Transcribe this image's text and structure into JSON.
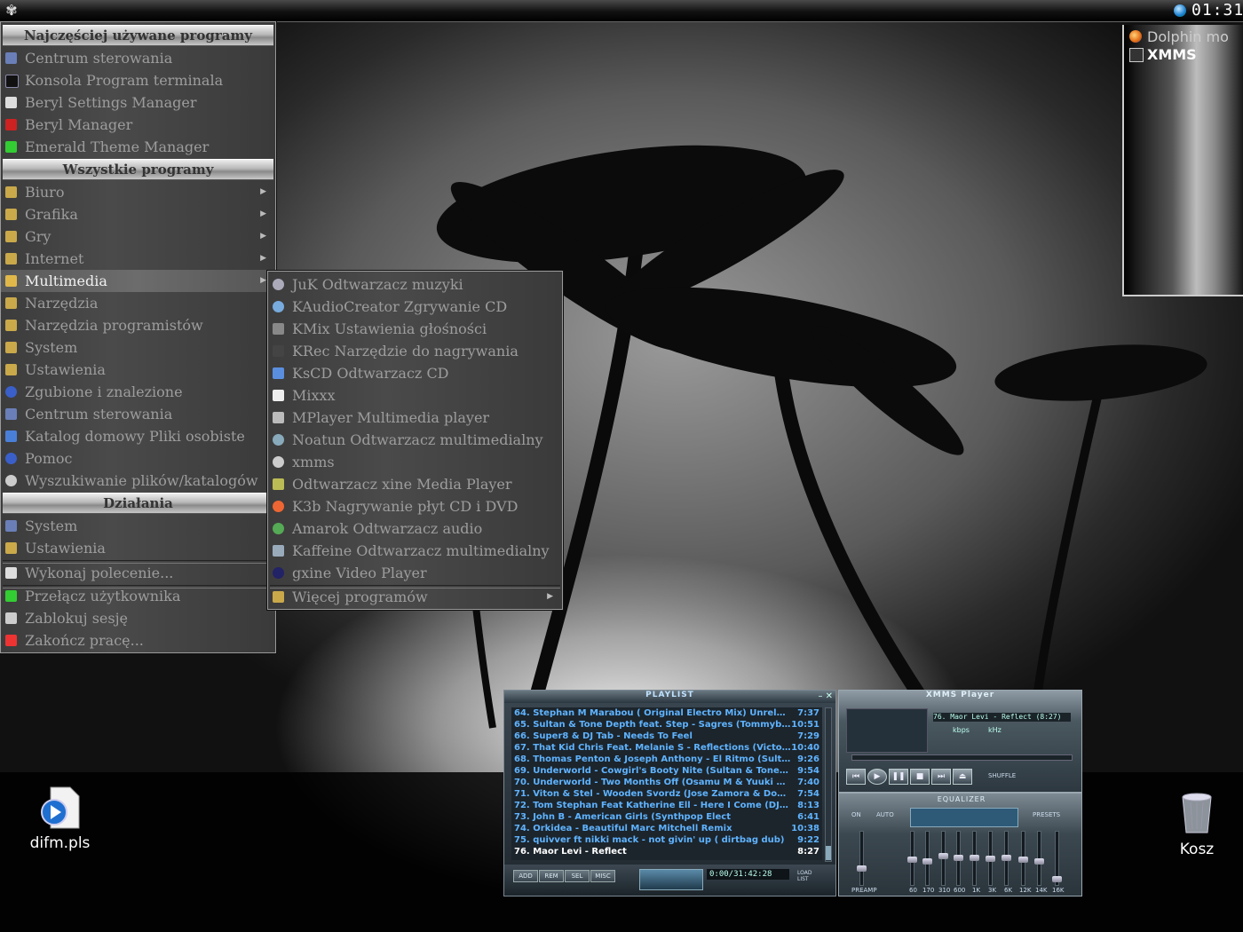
{
  "desktop": {
    "icons": [
      {
        "label": "difm.pls",
        "icon": "media-playlist-icon"
      },
      {
        "label": "Kosz",
        "icon": "trash-icon"
      }
    ]
  },
  "panel": {
    "clock": "01:31"
  },
  "taskbar_popup": {
    "items": [
      {
        "label": "Dolphin mo",
        "icon": "firefox-icon"
      },
      {
        "label": "XMMS",
        "icon": "xmms-icon"
      }
    ]
  },
  "kmenu": {
    "sections": {
      "recent": "Najczęściej używane programy",
      "all": "Wszystkie programy",
      "actions": "Działania"
    },
    "recent_items": [
      "Centrum sterowania",
      "Konsola Program terminala",
      "Beryl Settings Manager",
      "Beryl Manager",
      "Emerald Theme Manager"
    ],
    "all_items": [
      "Biuro",
      "Grafika",
      "Gry",
      "Internet",
      "Multimedia",
      "Narzędzia",
      "Narzędzia programistów",
      "System",
      "Ustawienia",
      "Zgubione i znalezione",
      "Centrum sterowania",
      "Katalog domowy Pliki osobiste",
      "Pomoc",
      "Wyszukiwanie plików/katalogów"
    ],
    "action_items": [
      "System",
      "Ustawienia"
    ],
    "run_command": "Wykonaj polecenie...",
    "session_items": [
      "Przełącz użytkownika",
      "Zablokuj sesję",
      "Zakończ pracę..."
    ]
  },
  "submenu": {
    "items": [
      "JuK Odtwarzacz muzyki",
      "KAudioCreator Zgrywanie CD",
      "KMix Ustawienia głośności",
      "KRec Narzędzie do nagrywania",
      "KsCD Odtwarzacz CD",
      "Mixxx",
      "MPlayer Multimedia player",
      "Noatun Odtwarzacz multimedialny",
      "xmms",
      "Odtwarzacz xine Media Player",
      "K3b Nagrywanie płyt CD i DVD",
      "Amarok Odtwarzacz audio",
      "Kaffeine Odtwarzacz multimedialny",
      "gxine Video Player"
    ],
    "more": "Więcej programów"
  },
  "playlist": {
    "title": "PLAYLIST",
    "rows": [
      {
        "title": "64. Stephan M Marabou ( Original Electro Mix) Unreleased",
        "duration": "7:37"
      },
      {
        "title": "65. Sultan & Tone Depth feat. Step - Sagres (Tommyboy Lov...",
        "duration": "10:51"
      },
      {
        "title": "66. Super8 & DJ Tab - Needs To Feel",
        "duration": "7:29"
      },
      {
        "title": "67. That Kid Chris Feat. Melanie S - Reflections (Victor Cald...",
        "duration": "10:40"
      },
      {
        "title": "68. Thomas Penton & Joseph Anthony - El Ritmo (Sultan & To...",
        "duration": "9:26"
      },
      {
        "title": "69. Underworld - Cowgirl's Booty Nite (Sultan & Tone Depth S...",
        "duration": "9:54"
      },
      {
        "title": "70. Underworld - Two Months Off (Osamu M & Yuuki Mix)",
        "duration": "7:40"
      },
      {
        "title": "71. Viton & Stel - Wooden Svordz (Jose Zamora & Dousk 'jdk...",
        "duration": "7:54"
      },
      {
        "title": "72. Tom Stephan Feat Katherine Ell - Here I Come (DJ Rooster...",
        "duration": "8:13"
      },
      {
        "title": "73. John B - American Girls (Synthpop Elect",
        "duration": "6:41"
      },
      {
        "title": "74. Orkidea - Beautiful Marc Mitchell Remix",
        "duration": "10:38"
      },
      {
        "title": "75. quivver ft nikki mack - not givin' up ( dirtbag dub)",
        "duration": "9:22"
      },
      {
        "title": "76. Maor Levi - Reflect",
        "duration": "8:27"
      }
    ],
    "buttons": [
      "ADD",
      "REM",
      "SEL",
      "MISC"
    ],
    "time": "0:00/31:42:28",
    "load_list": "LOAD LIST"
  },
  "xmms": {
    "title": "XMMS Player",
    "song": "76. Maor Levi - Reflect (8:27)",
    "kbps": "kbps",
    "khz": "kHz",
    "shuffle": "SHUFFLE"
  },
  "equalizer": {
    "title": "EQUALIZER",
    "on": "ON",
    "auto": "AUTO",
    "presets": "PRESETS",
    "preamp": "PREAMP",
    "bands": [
      "60",
      "170",
      "310",
      "600",
      "1K",
      "3K",
      "6K",
      "12K",
      "14K",
      "16K"
    ]
  }
}
